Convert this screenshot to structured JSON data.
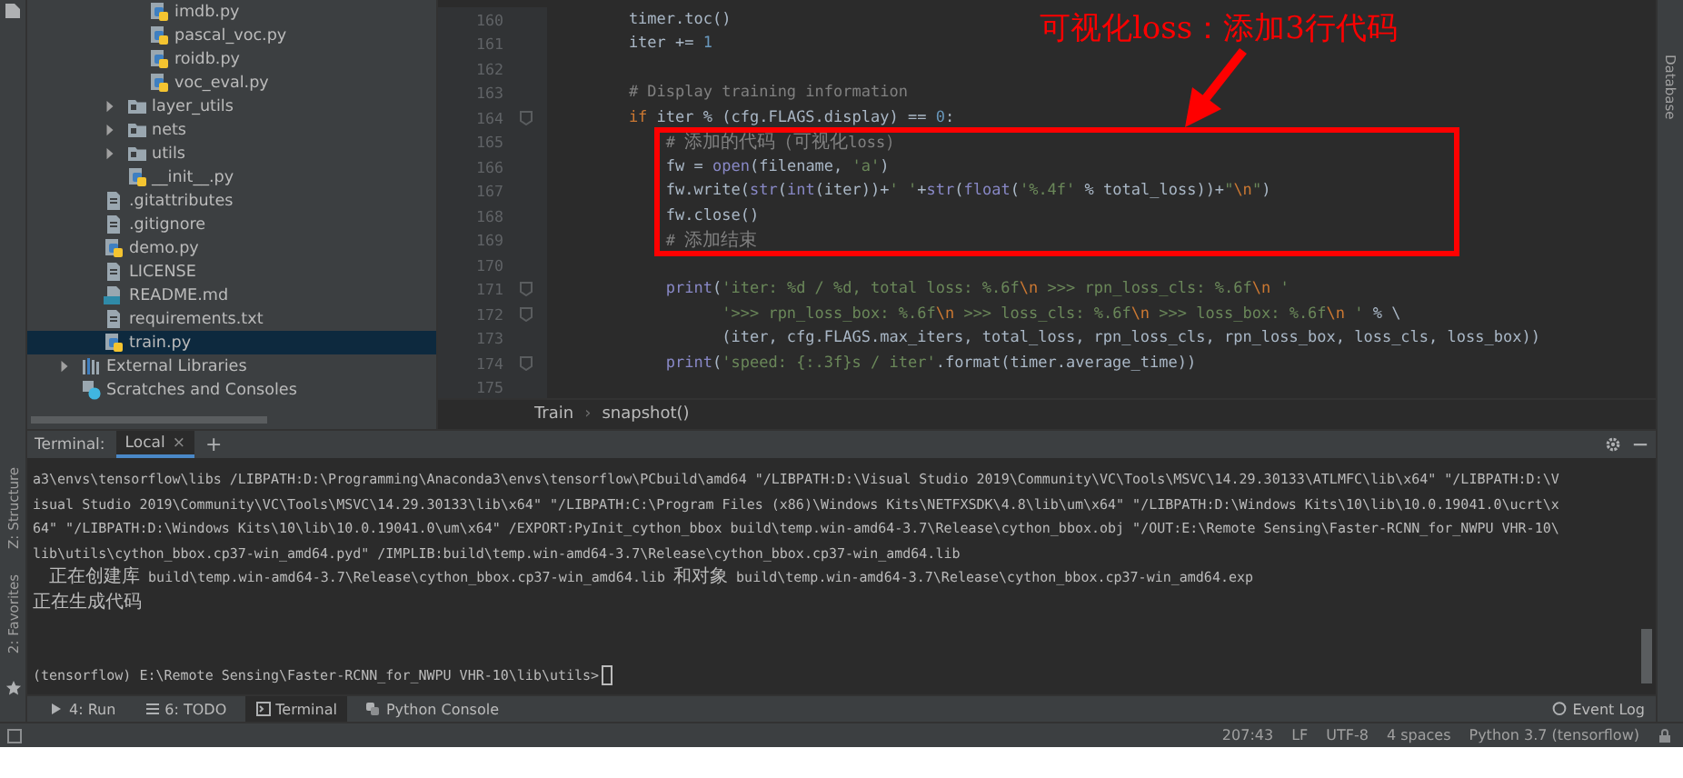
{
  "annotation": {
    "text": "可视化loss：添加3行代码"
  },
  "left_strip": {
    "labels": [
      "Z: Structure",
      "2: Favorites"
    ]
  },
  "right_strip": {
    "label": "Database"
  },
  "project_tree": {
    "items": [
      {
        "children": [
          {
            "children": [
              {
                "children": [
                  {
                    "label": "imdb.py",
                    "kind": "py",
                    "selected": false
                  },
                  {
                    "label": "pascal_voc.py",
                    "kind": "py",
                    "selected": false
                  },
                  {
                    "label": "roidb.py",
                    "kind": "py",
                    "selected": false
                  },
                  {
                    "label": "voc_eval.py",
                    "kind": "py",
                    "selected": false
                  }
                ]
              },
              {
                "label": "layer_utils",
                "kind": "folder",
                "expanded": false,
                "selected": false
              },
              {
                "label": "nets",
                "kind": "folder",
                "expanded": false,
                "selected": false
              },
              {
                "label": "utils",
                "kind": "folder",
                "expanded": false,
                "selected": false
              },
              {
                "label": "__init__.py",
                "kind": "py",
                "selected": false
              }
            ]
          },
          {
            "label": ".gitattributes",
            "kind": "file",
            "selected": false
          },
          {
            "label": ".gitignore",
            "kind": "file",
            "selected": false
          },
          {
            "label": "demo.py",
            "kind": "py",
            "selected": false
          },
          {
            "label": "LICENSE",
            "kind": "file",
            "selected": false
          },
          {
            "label": "README.md",
            "kind": "md",
            "selected": false
          },
          {
            "label": "requirements.txt",
            "kind": "file",
            "selected": false
          },
          {
            "label": "train.py",
            "kind": "py",
            "selected": true
          }
        ]
      },
      {
        "label": "External Libraries",
        "kind": "lib",
        "expanded": false,
        "selected": false
      },
      {
        "label": "Scratches and Consoles",
        "kind": "scratch",
        "selected": false
      }
    ]
  },
  "editor": {
    "lines": [
      {
        "number": "160",
        "segments": [
          {
            "kind": "plain",
            "text": "        timer.toc()"
          }
        ]
      },
      {
        "number": "161",
        "segments": [
          {
            "kind": "plain",
            "text": "        iter += "
          },
          {
            "kind": "num",
            "text": "1"
          }
        ]
      },
      {
        "number": "162"
      },
      {
        "number": "163",
        "segments": [
          {
            "kind": "comment",
            "text": "        # Display training information"
          }
        ]
      },
      {
        "number": "164",
        "fold": true,
        "segments": [
          {
            "kind": "kw",
            "text": "        if"
          },
          {
            "kind": "plain",
            "text": " iter % (cfg.FLAGS.display) == "
          },
          {
            "kind": "num",
            "text": "0"
          },
          {
            "kind": "plain",
            "text": ":"
          }
        ]
      },
      {
        "number": "165",
        "segments": [
          {
            "kind": "comment",
            "text": "            # 添加的代码（可视化loss）"
          }
        ]
      },
      {
        "number": "166",
        "segments": [
          {
            "kind": "plain",
            "text": "            fw = "
          },
          {
            "kind": "builtin",
            "text": "open"
          },
          {
            "kind": "plain",
            "text": "(filename, "
          },
          {
            "kind": "str",
            "text": "'a'"
          },
          {
            "kind": "plain",
            "text": ")"
          }
        ]
      },
      {
        "number": "167",
        "segments": [
          {
            "kind": "plain",
            "text": "            fw.write("
          },
          {
            "kind": "builtin",
            "text": "str"
          },
          {
            "kind": "plain",
            "text": "("
          },
          {
            "kind": "builtin",
            "text": "int"
          },
          {
            "kind": "plain",
            "text": "(iter))+"
          },
          {
            "kind": "str",
            "text": "' '"
          },
          {
            "kind": "plain",
            "text": "+"
          },
          {
            "kind": "builtin",
            "text": "str"
          },
          {
            "kind": "plain",
            "text": "("
          },
          {
            "kind": "builtin",
            "text": "float"
          },
          {
            "kind": "plain",
            "text": "("
          },
          {
            "kind": "str",
            "text": "'%.4f'"
          },
          {
            "kind": "plain",
            "text": " % total_loss))+"
          },
          {
            "kind": "str",
            "text": "\""
          },
          {
            "kind": "esc",
            "text": "\\n"
          },
          {
            "kind": "str",
            "text": "\""
          },
          {
            "kind": "plain",
            "text": ")"
          }
        ]
      },
      {
        "number": "168",
        "segments": [
          {
            "kind": "plain",
            "text": "            fw.close()"
          }
        ]
      },
      {
        "number": "169",
        "segments": [
          {
            "kind": "comment",
            "text": "            # 添加结束"
          }
        ]
      },
      {
        "number": "170"
      },
      {
        "number": "171",
        "fold": true,
        "segments": [
          {
            "kind": "builtin",
            "text": "            print"
          },
          {
            "kind": "plain",
            "text": "("
          },
          {
            "kind": "str",
            "text": "'iter: %d / %d, total loss: %.6f"
          },
          {
            "kind": "esc",
            "text": "\\n"
          },
          {
            "kind": "str",
            "text": " >>> rpn_loss_cls: %.6f"
          },
          {
            "kind": "esc",
            "text": "\\n"
          },
          {
            "kind": "str",
            "text": " '"
          }
        ]
      },
      {
        "number": "172",
        "fold": true,
        "segments": [
          {
            "kind": "str",
            "text": "                  '>>> rpn_loss_box: %.6f"
          },
          {
            "kind": "esc",
            "text": "\\n"
          },
          {
            "kind": "str",
            "text": " >>> loss_cls: %.6f"
          },
          {
            "kind": "esc",
            "text": "\\n"
          },
          {
            "kind": "str",
            "text": " >>> loss_box: %.6f"
          },
          {
            "kind": "esc",
            "text": "\\n"
          },
          {
            "kind": "str",
            "text": " '"
          },
          {
            "kind": "plain",
            "text": " % \\"
          }
        ]
      },
      {
        "number": "173",
        "segments": [
          {
            "kind": "plain",
            "text": "                  (iter, cfg.FLAGS.max_iters, total_loss, rpn_loss_cls, rpn_loss_box, loss_cls, loss_box))"
          }
        ]
      },
      {
        "number": "174",
        "fold": true,
        "segments": [
          {
            "kind": "builtin",
            "text": "            print"
          },
          {
            "kind": "plain",
            "text": "("
          },
          {
            "kind": "str",
            "text": "'speed: {:.3f}s / iter'"
          },
          {
            "kind": "plain",
            "text": ".format(timer.average_time))"
          }
        ]
      },
      {
        "number": "175"
      }
    ],
    "breadcrumb": {
      "items": [
        "Train",
        "snapshot()"
      ],
      "separator": "›"
    }
  },
  "terminal": {
    "label": "Terminal:",
    "tabs": [
      {
        "label": "Local",
        "close": "×",
        "selected": true
      }
    ],
    "add": "+",
    "lines": [
      "a3\\envs\\tensorflow\\libs /LIBPATH:D:\\Programming\\Anaconda3\\envs\\tensorflow\\PCbuild\\amd64 \"/LIBPATH:D:\\Visual Studio 2019\\Community\\VC\\Tools\\MSVC\\14.29.30133\\ATLMFC\\lib\\x64\" \"/LIBPATH:D:\\V",
      "isual Studio 2019\\Community\\VC\\Tools\\MSVC\\14.29.30133\\lib\\x64\" \"/LIBPATH:C:\\Program Files (x86)\\Windows Kits\\NETFXSDK\\4.8\\lib\\um\\x64\" \"/LIBPATH:D:\\Windows Kits\\10\\lib\\10.0.19041.0\\ucrt\\x",
      "64\" \"/LIBPATH:D:\\Windows Kits\\10\\lib\\10.0.19041.0\\um\\x64\" /EXPORT:PyInit_cython_bbox build\\temp.win-amd64-3.7\\Release\\cython_bbox.obj \"/OUT:E:\\Remote Sensing\\Faster-RCNN_for_NWPU VHR-10\\",
      "lib\\utils\\cython_bbox.cp37-win_amd64.pyd\" /IMPLIB:build\\temp.win-amd64-3.7\\Release\\cython_bbox.cp37-win_amd64.lib",
      "  正在创建库 build\\temp.win-amd64-3.7\\Release\\cython_bbox.cp37-win_amd64.lib 和对象 build\\temp.win-amd64-3.7\\Release\\cython_bbox.cp37-win_amd64.exp",
      "正在生成代码"
    ],
    "prompt": "(tensorflow) E:\\Remote Sensing\\Faster-RCNN_for_NWPU VHR-10\\lib\\utils>"
  },
  "tool_windows": {
    "items": [
      {
        "label": "4: Run",
        "kind": "run",
        "selected": false
      },
      {
        "label": "6: TODO",
        "kind": "todo",
        "selected": false
      },
      {
        "label": "Terminal",
        "kind": "terminal",
        "selected": true
      },
      {
        "label": "Python Console",
        "kind": "console",
        "selected": false
      }
    ],
    "event_log": "Event Log"
  },
  "status_bar": [
    "207:43",
    "LF",
    "UTF-8",
    "4 spaces",
    "Python 3.7 (tensorflow)"
  ]
}
